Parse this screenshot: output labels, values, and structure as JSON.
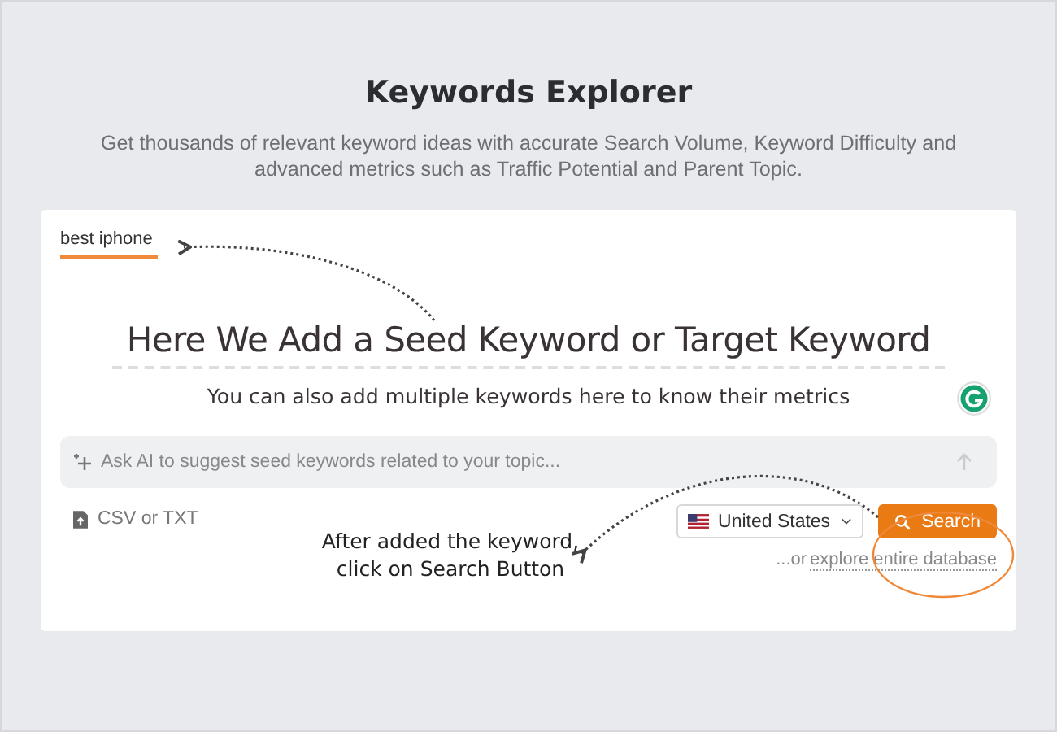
{
  "header": {
    "title": "Keywords Explorer",
    "subtitle": "Get thousands of relevant keyword ideas with accurate Search Volume, Keyword Difficulty and advanced metrics such as Traffic Potential and Parent Topic."
  },
  "keyword_input": {
    "value": "best iphone"
  },
  "annotation": {
    "heading": "Here We Add a Seed Keyword or Target Keyword",
    "note": "You can also add multiple keywords here to know their metrics",
    "callout": "After added the keyword, click on Search Button"
  },
  "ai_field": {
    "placeholder": "Ask AI to suggest seed keywords related to your topic..."
  },
  "upload": {
    "label": "CSV or TXT"
  },
  "country": {
    "label": "United States"
  },
  "search_button": {
    "label": "Search"
  },
  "explore": {
    "prefix": "...or",
    "link": "explore entire database"
  }
}
